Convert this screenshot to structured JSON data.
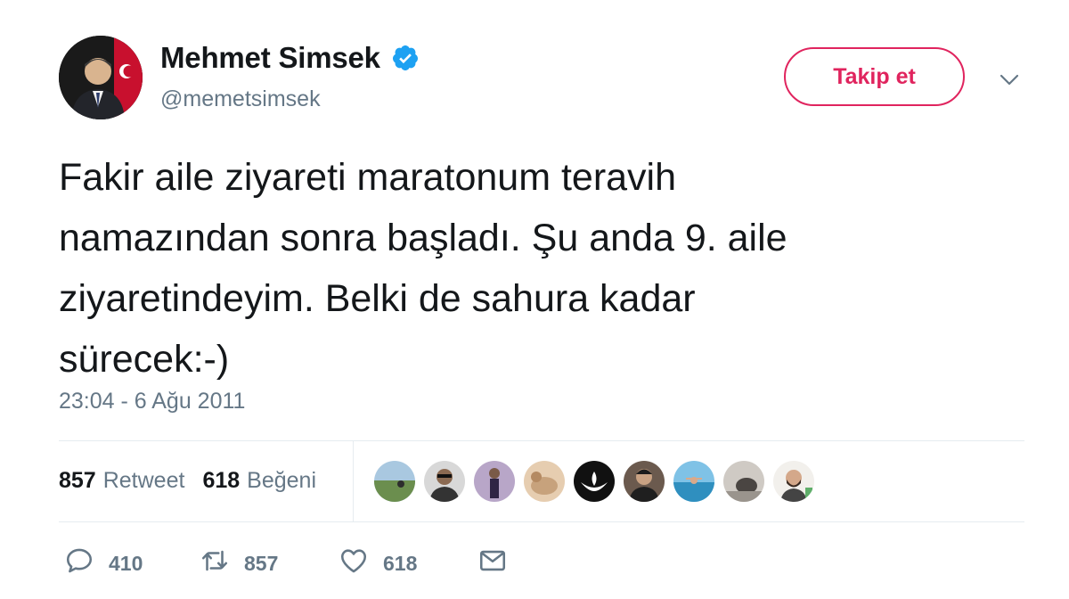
{
  "user": {
    "name": "Mehmet Simsek",
    "handle": "@memetsimsek",
    "verified": true
  },
  "follow_button": {
    "label": "Takip et"
  },
  "tweet": {
    "lines": [
      "Fakir aile ziyareti maratonum teravih",
      "namazından sonra başladı. Şu anda 9. aile",
      "ziyaretindeyim. Belki de sahura kadar",
      "sürecek:-)"
    ],
    "timestamp": "23:04 - 6 Ağu 2011"
  },
  "stats": {
    "retweets": {
      "count": "857",
      "label": "Retweet"
    },
    "likes": {
      "count": "618",
      "label": "Beğeni"
    }
  },
  "likers": [
    {
      "icon": "avatar-landscape",
      "color": "#6b8e4e"
    },
    {
      "icon": "avatar-person-sunglasses",
      "color": "#4a4a4a"
    },
    {
      "icon": "avatar-person-standing",
      "color": "#5b4a6e"
    },
    {
      "icon": "avatar-animal",
      "color": "#c7a27c"
    },
    {
      "icon": "avatar-lotus-logo",
      "color": "#111111"
    },
    {
      "icon": "avatar-person-dark",
      "color": "#3b2f2a"
    },
    {
      "icon": "avatar-sea",
      "color": "#4fa6cf"
    },
    {
      "icon": "avatar-gray",
      "color": "#8a8580"
    },
    {
      "icon": "avatar-person-beard",
      "color": "#e8e4de"
    }
  ],
  "actions": {
    "reply_count": "410",
    "retweet_count": "857",
    "like_count": "618"
  },
  "colors": {
    "accent": "#e0245e",
    "verified": "#1da1f2",
    "secondary_text": "#657786",
    "primary_text": "#14171a",
    "divider": "#e6ecf0"
  }
}
